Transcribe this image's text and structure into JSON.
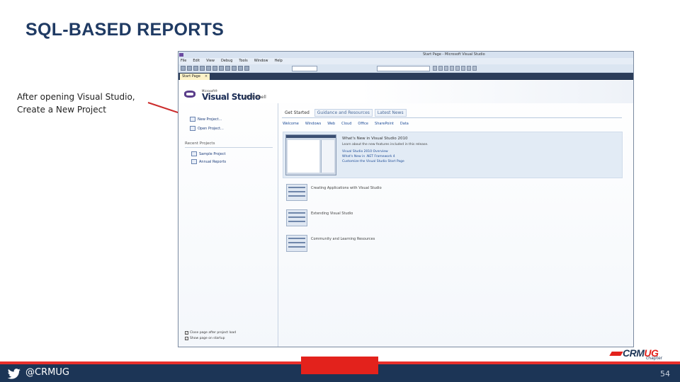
{
  "slide": {
    "title": "SQL-BASED REPORTS",
    "caption": "After opening Visual Studio, Create a New Project",
    "footer_handle": "@CRMUG",
    "page_number": "54",
    "logo_text_a": "CRM",
    "logo_text_b": "UG",
    "logo_sub": "chapter"
  },
  "colors": {
    "title": "#1f3a63",
    "footer": "#1c3556",
    "accent_red": "#e3221c",
    "callout": "#cc2b2b"
  },
  "vs": {
    "window_title": "Start Page - Microsoft Visual Studio",
    "menu": [
      "File",
      "Edit",
      "View",
      "Debug",
      "Tools",
      "Window",
      "Help"
    ],
    "doc_tab": "Start Page",
    "doc_tab_close": "×",
    "logo_small": "Microsoft®",
    "logo_main": "Visual Studio",
    "logo_version": "2010 Shell",
    "left": {
      "new_project": "New Project...",
      "open_project": "Open Project...",
      "recent_header": "Recent Projects",
      "recent": [
        "Sample Project",
        "Annual Reports"
      ],
      "check_close": "Close page after project load",
      "check_show": "Show page on startup"
    },
    "tabs": [
      "Get Started",
      "Guidance and Resources",
      "Latest News"
    ],
    "subtabs": [
      "Welcome",
      "Windows",
      "Web",
      "Cloud",
      "Office",
      "SharePoint",
      "Data"
    ],
    "feature": {
      "title": "What's New in Visual Studio 2010",
      "desc": "Learn about the new features included in this release.",
      "links": [
        "Visual Studio 2010 Overview",
        "What's New in .NET Framework 4",
        "Customize the Visual Studio Start Page"
      ]
    },
    "items": [
      "Creating Applications with Visual Studio",
      "Extending Visual Studio",
      "Community and Learning Resources"
    ]
  }
}
